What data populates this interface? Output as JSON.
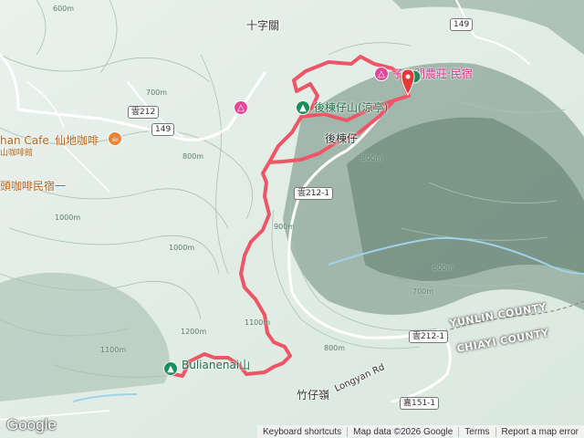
{
  "map": {
    "route_color": "#ee5566",
    "place_labels": {
      "shizi_guan": "十字關",
      "route_149": "149",
      "route_212": "雲212",
      "route_212_1_a": "雲212-1",
      "route_212_1_b": "雲212-1",
      "route_151_1": "嘉151-1",
      "farm_stay": "子休閒農莊‧民宿",
      "peak_name": "後棟仔山(涼亭)",
      "hou_dong": "後棟仔",
      "cafe_en": "han Cafe",
      "cafe_zh": "仙地咖啡",
      "cafe_small": "山咖啡館",
      "homestay_left": "頭咖啡民宿一",
      "trailhead": "Bulianenai山",
      "zhuzai_ling": "竹仔嶺",
      "longyan_rd": "Longyan Rd",
      "yunlin": "YUNLIN COUNTY",
      "chiayi": "CHIAYI COUNTY"
    },
    "contour_labels": [
      "600m",
      "700m",
      "800m",
      "800m",
      "900m",
      "1000m",
      "1000m",
      "1100m",
      "1200m",
      "1100m",
      "600m",
      "700m",
      "800m"
    ],
    "icons": {
      "peak_icon": "tree-icon",
      "hotel_icon": "bed-icon",
      "cafe_icon": "coffee-icon",
      "marker_icon": "location-pin-icon"
    }
  },
  "branding": {
    "logo": "Google"
  },
  "attribution": {
    "shortcuts": "Keyboard shortcuts",
    "map_data": "Map data ©2026 Google",
    "terms": "Terms",
    "report": "Report a map error"
  }
}
